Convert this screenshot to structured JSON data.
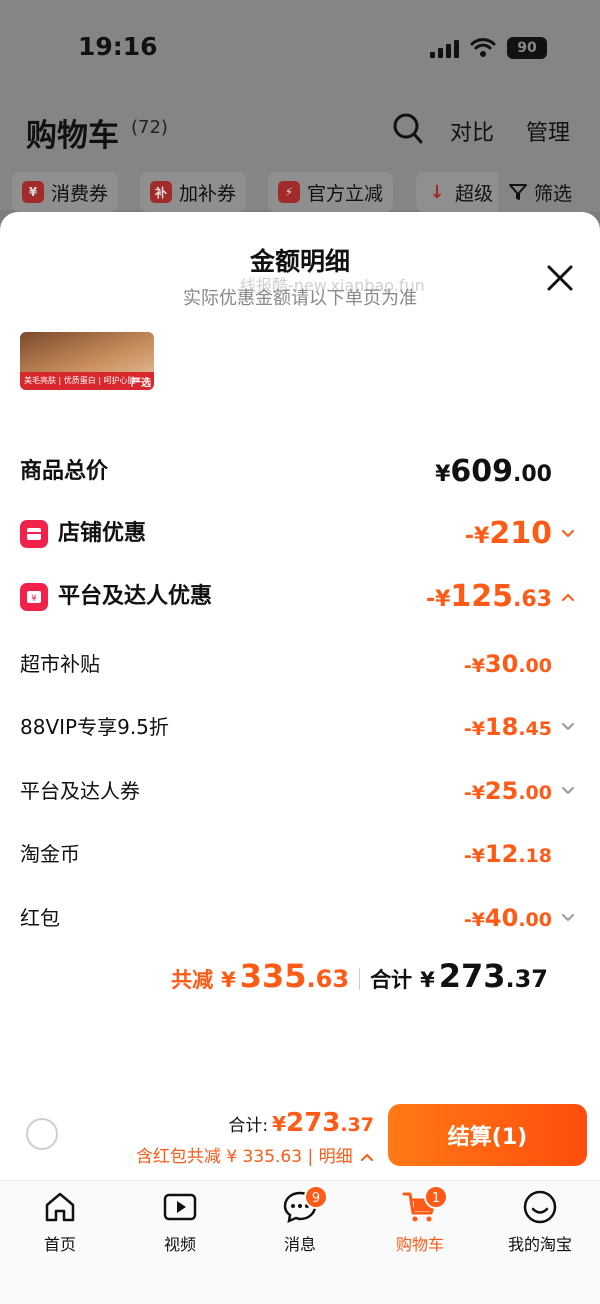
{
  "status_bar": {
    "time": "19:16",
    "battery": "90"
  },
  "header": {
    "title": "购物车",
    "count": "(72)",
    "compare": "对比",
    "manage": "管理"
  },
  "chips": [
    {
      "icon": "¥",
      "label": "消费券"
    },
    {
      "icon": "补",
      "label": "加补券"
    },
    {
      "icon": "⚡",
      "label": "官方立减"
    },
    {
      "icon": "↓",
      "label": "超级"
    }
  ],
  "filter_label": "筛选",
  "sheet": {
    "title": "金额明细",
    "subtitle": "实际优惠金额请以下单页为准",
    "watermark": "线报酷-new.xianbao.fun"
  },
  "product": {
    "band": "美毛亮肤 | 优质蛋白 | 呵护心脏",
    "tag": "严选"
  },
  "rows": {
    "total": {
      "label": "商品总价",
      "yen": "¥",
      "int": "609",
      "dec": ".00"
    },
    "store": {
      "label": "店铺优惠",
      "yen": "-¥",
      "int": "210",
      "dec": ""
    },
    "platform": {
      "label": "平台及达人优惠",
      "yen": "-¥",
      "int": "125",
      "dec": ".63"
    },
    "supermarket": {
      "label": "超市补贴",
      "yen": "-¥",
      "int": "30",
      "dec": ".00"
    },
    "vip": {
      "label": "88VIP专享9.5折",
      "yen": "-¥",
      "int": "18",
      "dec": ".45"
    },
    "coupon": {
      "label": "平台及达人券",
      "yen": "-¥",
      "int": "25",
      "dec": ".00"
    },
    "coins": {
      "label": "淘金币",
      "yen": "-¥",
      "int": "12",
      "dec": ".18"
    },
    "redpacket": {
      "label": "红包",
      "yen": "-¥",
      "int": "40",
      "dec": ".00"
    }
  },
  "summary": {
    "saved_label": "共减",
    "saved_yen": "¥",
    "saved_int": "335",
    "saved_dec": ".63",
    "total_label": "合计",
    "total_yen": "¥",
    "total_int": "273",
    "total_dec": ".37"
  },
  "bottom": {
    "sum_label": "合计:",
    "sum_yen": "¥",
    "sum_int": "273",
    "sum_dec": ".37",
    "sub": "含红包共减 ¥ 335.63 | 明细",
    "checkout": "结算(1)"
  },
  "tabs": [
    {
      "label": "首页",
      "icon": "home-icon"
    },
    {
      "label": "视频",
      "icon": "video-icon"
    },
    {
      "label": "消息",
      "icon": "message-icon",
      "badge": "9"
    },
    {
      "label": "购物车",
      "icon": "cart-icon",
      "badge": "1"
    },
    {
      "label": "我的淘宝",
      "icon": "profile-icon"
    }
  ],
  "colors": {
    "accent": "#ff5a16",
    "store_icon": "#f0224a"
  }
}
